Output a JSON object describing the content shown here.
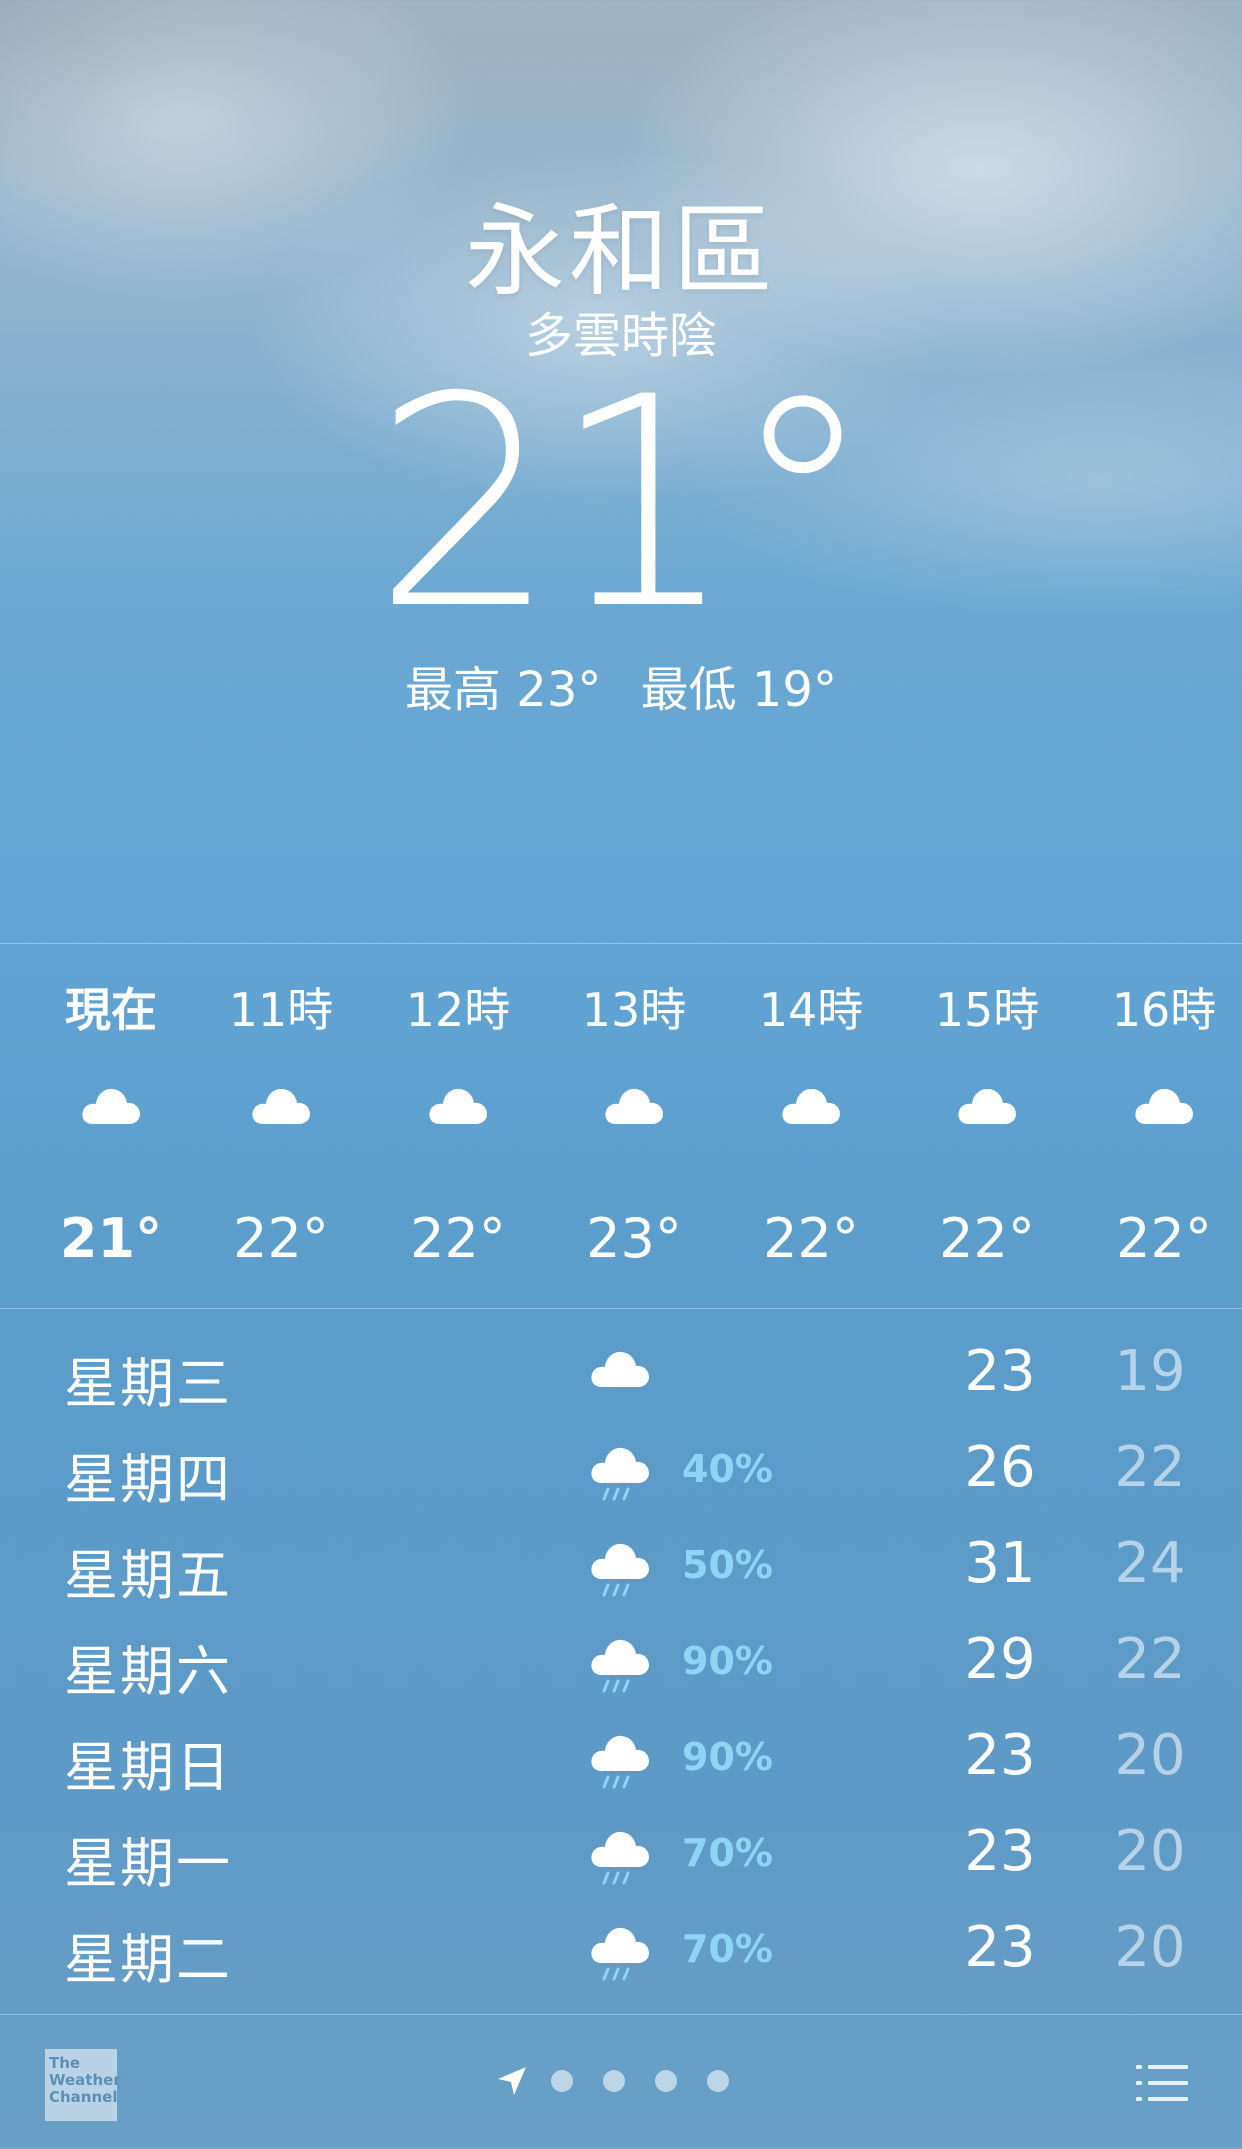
{
  "location": {
    "city": "永和區",
    "condition": "多雲時陰",
    "temperature": "21°",
    "high": "最高 23°",
    "low": "最低 19°"
  },
  "hourly": [
    {
      "label": "現在",
      "temp": "21°",
      "icon": "cloud-icon"
    },
    {
      "label": "11時",
      "temp": "22°",
      "icon": "cloud-icon"
    },
    {
      "label": "12時",
      "temp": "22°",
      "icon": "cloud-icon"
    },
    {
      "label": "13時",
      "temp": "23°",
      "icon": "cloud-icon"
    },
    {
      "label": "14時",
      "temp": "22°",
      "icon": "cloud-icon"
    },
    {
      "label": "15時",
      "temp": "22°",
      "icon": "cloud-icon"
    },
    {
      "label": "16時",
      "temp": "22°",
      "icon": "cloud-icon"
    }
  ],
  "daily": [
    {
      "day": "星期三",
      "icon": "cloud-icon",
      "precip": "",
      "high": "23",
      "low": "19"
    },
    {
      "day": "星期四",
      "icon": "rain-cloud-icon",
      "precip": "40%",
      "high": "26",
      "low": "22"
    },
    {
      "day": "星期五",
      "icon": "rain-cloud-icon",
      "precip": "50%",
      "high": "31",
      "low": "24"
    },
    {
      "day": "星期六",
      "icon": "rain-cloud-icon",
      "precip": "90%",
      "high": "29",
      "low": "22"
    },
    {
      "day": "星期日",
      "icon": "rain-cloud-icon",
      "precip": "90%",
      "high": "23",
      "low": "20"
    },
    {
      "day": "星期一",
      "icon": "rain-cloud-icon",
      "precip": "70%",
      "high": "23",
      "low": "20"
    },
    {
      "day": "星期二",
      "icon": "rain-cloud-icon",
      "precip": "70%",
      "high": "23",
      "low": "20"
    }
  ],
  "footer": {
    "logo_text": "The Weather Channel",
    "page_count": 4,
    "current_page_icon": "location-arrow-icon",
    "list_icon": "list-icon"
  },
  "colors": {
    "precip_text": "#8fd4f5",
    "sky_top": "#9fb3c2",
    "sky_bottom": "#5b9cca"
  }
}
